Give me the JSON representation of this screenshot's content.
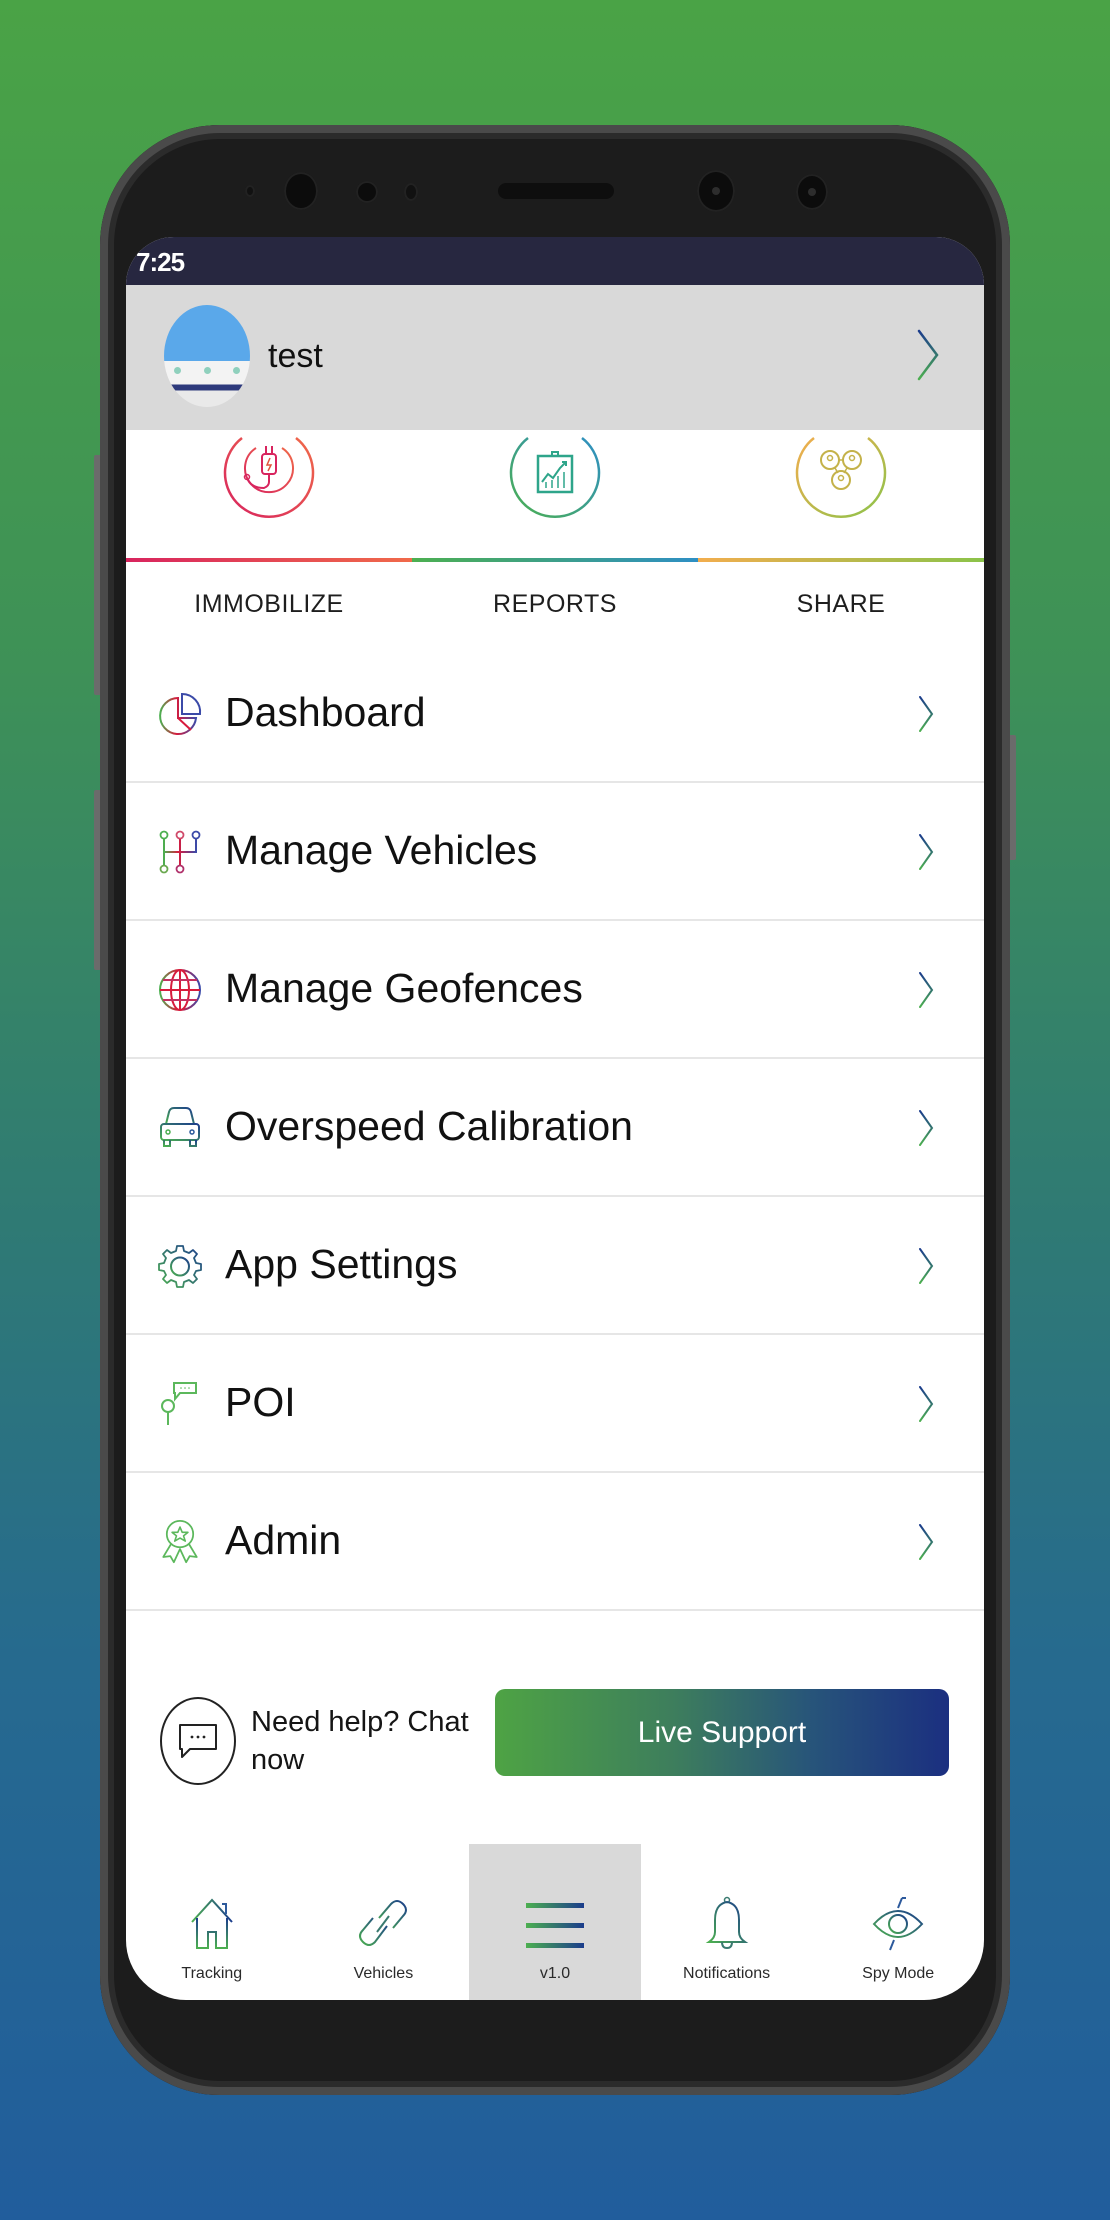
{
  "status_bar": {
    "time": "7:25"
  },
  "profile": {
    "name": "test"
  },
  "quick_actions": [
    {
      "label": "IMMOBILIZE",
      "icon": "plug-icon",
      "color_start": "#d8245e",
      "color_end": "#f06a4a"
    },
    {
      "label": "REPORTS",
      "icon": "chart-board-icon",
      "color_start": "#4caf50",
      "color_end": "#2e8fc4"
    },
    {
      "label": "SHARE",
      "icon": "share-people-icon",
      "color_start": "#f2ad4e",
      "color_end": "#8bc34a"
    }
  ],
  "menu": {
    "items": [
      {
        "label": "Dashboard",
        "icon": "pie-chart-icon"
      },
      {
        "label": "Manage Vehicles",
        "icon": "gear-shift-icon"
      },
      {
        "label": "Manage Geofences",
        "icon": "globe-icon"
      },
      {
        "label": "Overspeed Calibration",
        "icon": "car-icon"
      },
      {
        "label": "App Settings",
        "icon": "gear-icon"
      },
      {
        "label": "POI",
        "icon": "pin-chat-icon"
      },
      {
        "label": "Admin",
        "icon": "award-icon"
      }
    ]
  },
  "help": {
    "text": "Need help? Chat now",
    "button_label": "Live Support"
  },
  "bottom_nav": {
    "items": [
      {
        "label": "Tracking",
        "icon": "home-icon",
        "active": false
      },
      {
        "label": "Vehicles",
        "icon": "link-icon",
        "active": false
      },
      {
        "label": "v1.0",
        "icon": "menu-icon",
        "active": true
      },
      {
        "label": "Notifications",
        "icon": "bell-icon",
        "active": false
      },
      {
        "label": "Spy Mode",
        "icon": "eye-icon",
        "active": false
      }
    ]
  },
  "colors": {
    "brand_green": "#4ea344",
    "brand_blue": "#1b2f80",
    "header_gray": "#d9d9d9",
    "status_bar": "#272740"
  }
}
